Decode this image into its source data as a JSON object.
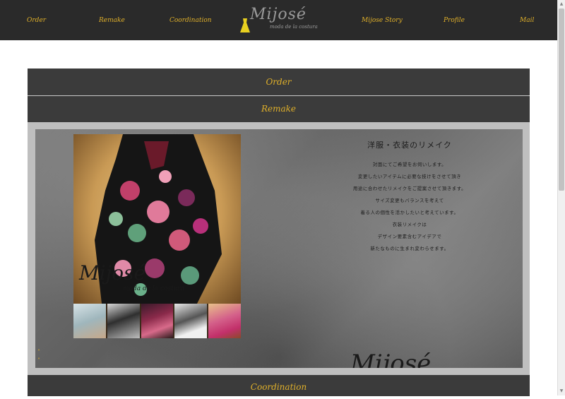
{
  "nav": {
    "items": [
      "Order",
      "Remake",
      "Coordination",
      "Mijose Story",
      "Profile",
      "Mail"
    ],
    "logo_text": "Mijosé",
    "logo_sub": "moda de la costura"
  },
  "accordion": {
    "order_label": "Order",
    "remake_label": "Remake",
    "coordination_label": "Coordination"
  },
  "remake": {
    "title": "洋服・衣装のリメイク",
    "lines": [
      "対面にてご希望をお伺いします。",
      "変更したいアイテムに必要な技けをさせて頂き",
      "用途に合わせたリメイクをご提案させて頂きます。",
      "サイズ変更もバランスを考えて",
      "着る人の個性を活かしたいと考えています。",
      "衣装リメイクは",
      "デザイン要素含むアイデアで",
      "新たなものに生まれ変わらせます。"
    ],
    "photo_logo": "Mijosé",
    "photo_logo_sub": "moda de la costura",
    "bottom_logo": "Mijosé"
  },
  "colors": {
    "accent": "#e0b02a",
    "bar": "#2a2a2a",
    "header": "#3b3b3b"
  }
}
